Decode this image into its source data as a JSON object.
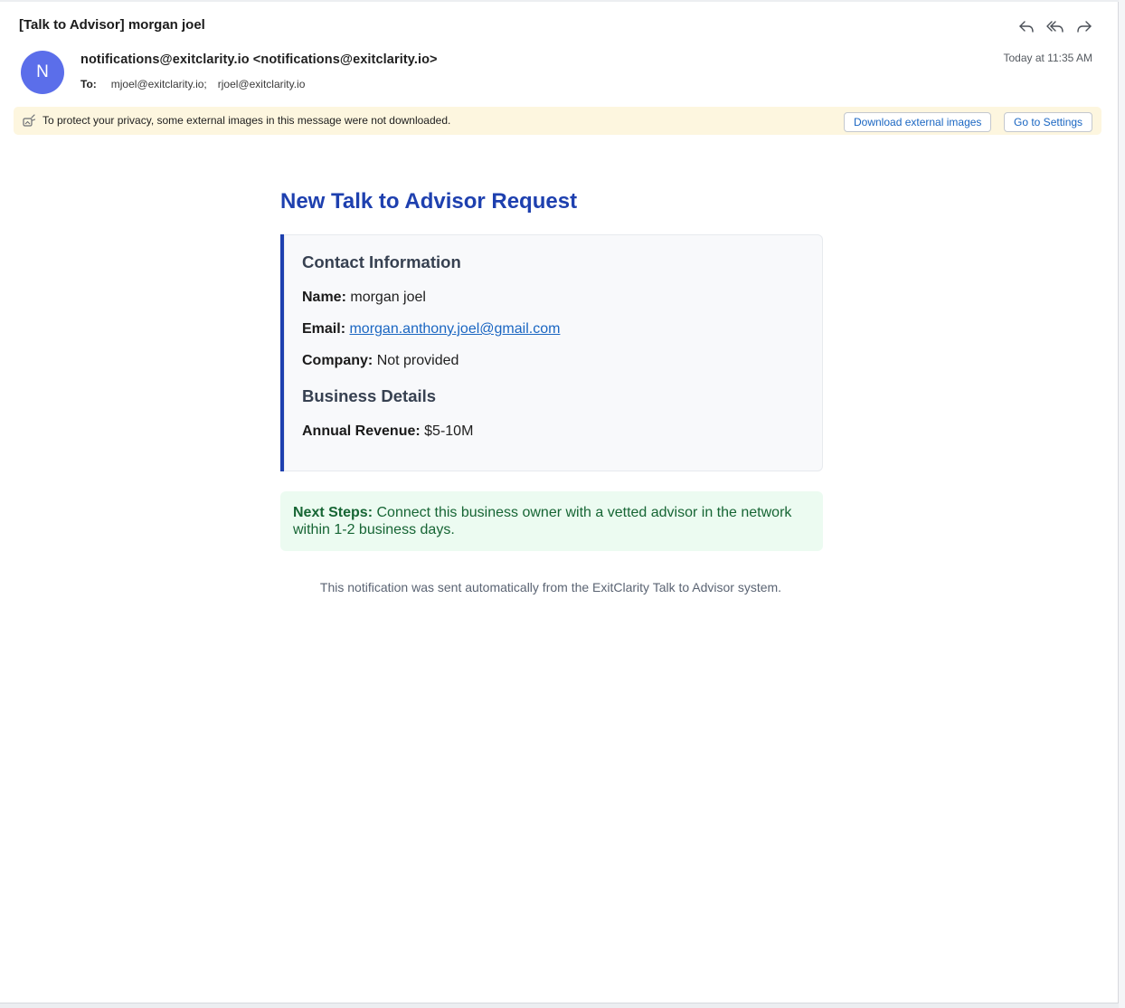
{
  "email": {
    "subject": "[Talk to Advisor] morgan joel",
    "avatar_initial": "N",
    "from": "notifications@exitclarity.io <notifications@exitclarity.io>",
    "to_label": "To:",
    "recipients": [
      "mjoel@exitclarity.io;",
      "rjoel@exitclarity.io"
    ],
    "timestamp": "Today at 11:35 AM",
    "actions": [
      {
        "name": "reply",
        "icon": "reply-icon"
      },
      {
        "name": "reply-all",
        "icon": "reply-all-icon"
      },
      {
        "name": "forward",
        "icon": "forward-icon"
      }
    ]
  },
  "privacy_bar": {
    "icon": "blocked-image-icon",
    "message": "To protect your privacy, some external images in this message were not downloaded.",
    "download_label": "Download external images",
    "settings_label": "Go to Settings"
  },
  "body": {
    "title": "New Talk to Advisor Request",
    "contact_section": "Contact Information",
    "name_label": "Name:",
    "name_value": "morgan joel",
    "email_label": "Email:",
    "email_value": "morgan.anthony.joel@gmail.com",
    "company_label": "Company:",
    "company_value": "Not provided",
    "business_section": "Business Details",
    "revenue_label": "Annual Revenue:",
    "revenue_value": "$5-10M",
    "next_steps_label": "Next Steps:",
    "next_steps_text": "Connect this business owner with a vetted advisor in the network within 1-2 business days.",
    "footer": "This notification was sent automatically from the ExitClarity Talk to Advisor system."
  },
  "colors": {
    "accent": "#1e40af",
    "avatar": "#5b6eea",
    "next_steps_bg": "#ecfbf1",
    "next_steps_text": "#166534",
    "privacy_bg": "#fdf6df",
    "link": "#1a66c2"
  }
}
